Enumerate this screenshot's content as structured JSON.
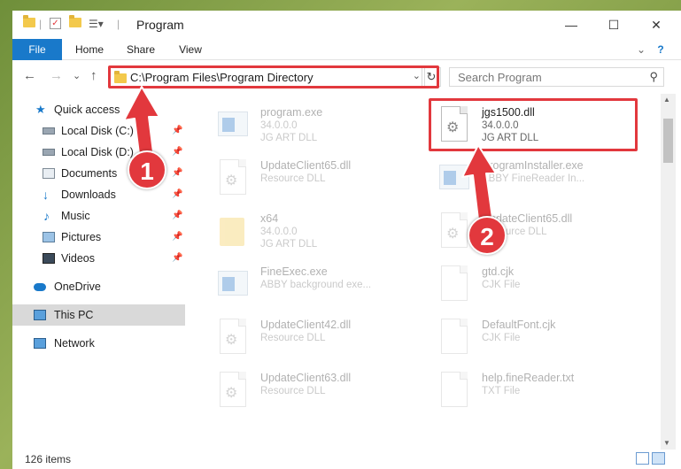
{
  "window": {
    "title": "Program",
    "minimize_glyph": "—",
    "maximize_glyph": "☐",
    "close_glyph": "✕"
  },
  "ribbon": {
    "tabs": [
      "File",
      "Home",
      "Share",
      "View"
    ],
    "help_glyph": "?",
    "collapse_glyph": "⌄"
  },
  "address": {
    "back_glyph": "←",
    "forward_glyph": "→",
    "recent_glyph": "⌄",
    "up_glyph": "↑",
    "path": "C:\\Program Files\\Program Directory",
    "dropdown_glyph": "⌄",
    "refresh_glyph": "↻",
    "search_placeholder": "Search Program",
    "search_glyph": "⚲"
  },
  "sidebar": {
    "items": [
      {
        "label": "Quick access",
        "icon": "star-icon",
        "pinned": false
      },
      {
        "label": "Local Disk (C:)",
        "icon": "drive-icon",
        "pinned": true
      },
      {
        "label": "Local Disk (D:)",
        "icon": "drive-icon",
        "pinned": true
      },
      {
        "label": "Documents",
        "icon": "documents-icon",
        "pinned": true
      },
      {
        "label": "Downloads",
        "icon": "download-icon",
        "pinned": true
      },
      {
        "label": "Music",
        "icon": "music-icon",
        "pinned": true
      },
      {
        "label": "Pictures",
        "icon": "pictures-icon",
        "pinned": true
      },
      {
        "label": "Videos",
        "icon": "videos-icon",
        "pinned": true
      },
      {
        "label": "OneDrive",
        "icon": "cloud-icon",
        "pinned": false
      },
      {
        "label": "This PC",
        "icon": "computer-icon",
        "pinned": false,
        "selected": true
      },
      {
        "label": "Network",
        "icon": "network-icon",
        "pinned": false
      }
    ],
    "pin_glyph": "📌"
  },
  "files": [
    {
      "name": "program.exe",
      "line2": "34.0.0.0",
      "line3": "JG ART DLL",
      "kind": "exe"
    },
    {
      "name": "jgs1500.dll",
      "line2": "34.0.0.0",
      "line3": "JG ART DLL",
      "kind": "dll",
      "highlighted": true
    },
    {
      "name": "UpdateClient65.dll",
      "line2": "Resource DLL",
      "line3": "",
      "kind": "dll"
    },
    {
      "name": "ProgramInstaller.exe",
      "line2": "ABBY FineReader In...",
      "line3": "",
      "kind": "exe"
    },
    {
      "name": "x64",
      "line2": "34.0.0.0",
      "line3": "JG ART DLL",
      "kind": "folder"
    },
    {
      "name": "UpdateClient65.dll",
      "line2": "Resource DLL",
      "line3": "",
      "kind": "dll"
    },
    {
      "name": "FineExec.exe",
      "line2": "ABBY background exe...",
      "line3": "",
      "kind": "exe"
    },
    {
      "name": "gtd.cjk",
      "line2": "CJK File",
      "line3": "",
      "kind": "doc"
    },
    {
      "name": "UpdateClient42.dll",
      "line2": "Resource DLL",
      "line3": "",
      "kind": "dll"
    },
    {
      "name": "DefaultFont.cjk",
      "line2": "CJK File",
      "line3": "",
      "kind": "doc"
    },
    {
      "name": "UpdateClient63.dll",
      "line2": "Resource DLL",
      "line3": "",
      "kind": "dll"
    },
    {
      "name": "help.fineReader.txt",
      "line2": "TXT File",
      "line3": "",
      "kind": "doc"
    }
  ],
  "annotations": {
    "step1": "1",
    "step2": "2",
    "highlight_color": "#e2383d"
  },
  "status": {
    "item_count": "126 items"
  }
}
